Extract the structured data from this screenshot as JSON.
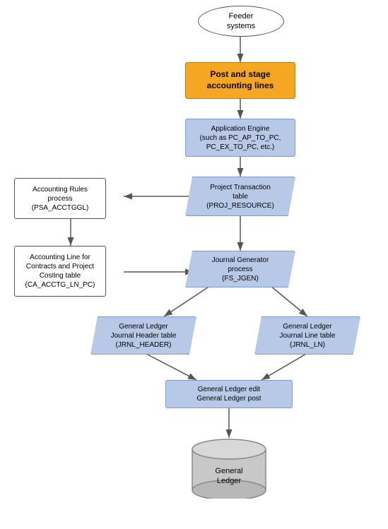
{
  "nodes": {
    "feeder": {
      "label": "Feeder\nsystems"
    },
    "post": {
      "label": "Post and stage\naccounting lines"
    },
    "appEngine": {
      "label": "Application Engine\n(such as PC_AP_TO_PC,\nPC_EX_TO_PC, etc.)"
    },
    "projTransaction": {
      "label": "Project Transaction\ntable\n(PROJ_RESOURCE)"
    },
    "accountingRules": {
      "label": "Accounting Rules\nprocess\n(PSA_ACCTGGL)"
    },
    "accountingLine": {
      "label": "Accounting Line for\nContracts and Project\nCosting table\n(CA_ACCTG_LN_PC)"
    },
    "journalGen": {
      "label": "Journal Generator\nprocess\n(FS_JGEN)"
    },
    "glHeader": {
      "label": "General Ledger\nJournal Header table\n(JRNL_HEADER)"
    },
    "glLine": {
      "label": "General Ledger\nJournal Line table\n(JRNL_LN)"
    },
    "glEdit": {
      "label": "General Ledger edit\nGeneral Ledger post"
    },
    "generalLedger": {
      "label": "General\nLedger"
    }
  }
}
